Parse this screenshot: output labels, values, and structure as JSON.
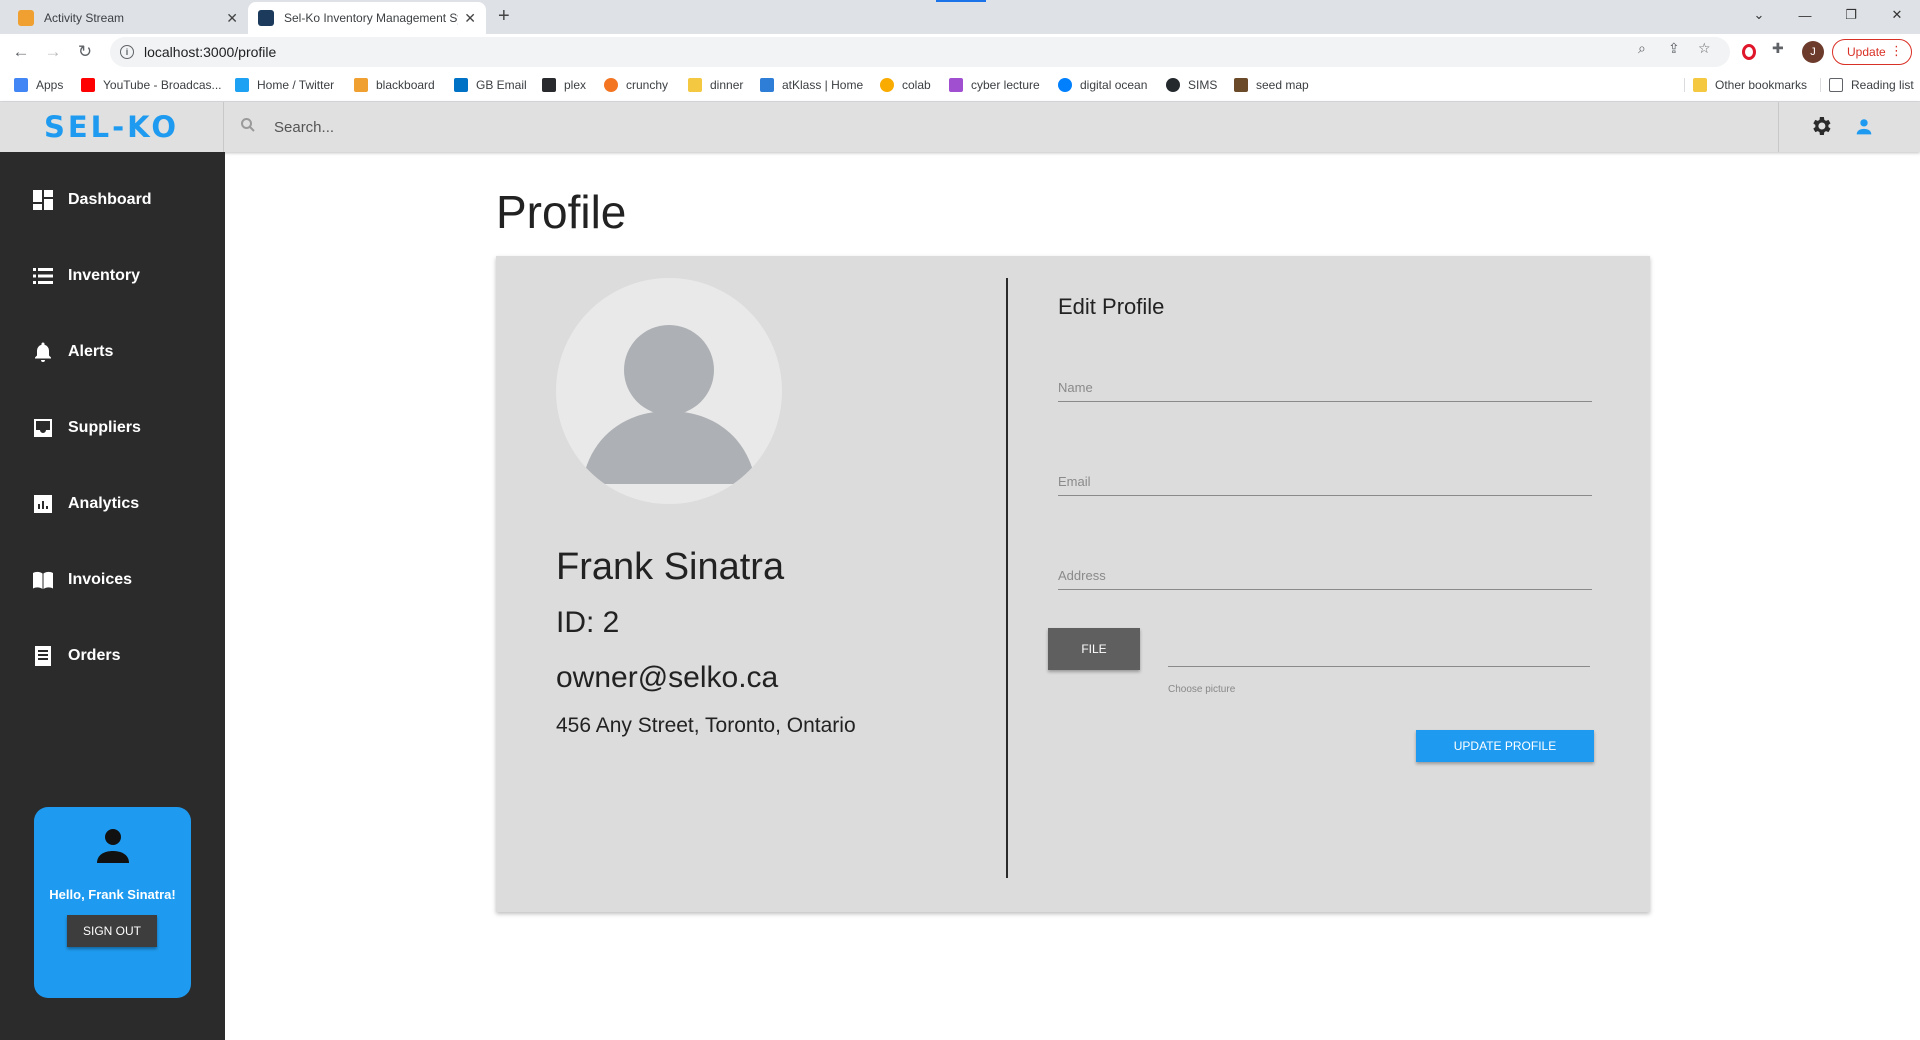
{
  "browser": {
    "tabs": [
      {
        "title": "Activity Stream",
        "fav_color": "#f0a030"
      },
      {
        "title": "Sel-Ko Inventory Management Sy",
        "fav_color": "#1b3a5c"
      }
    ],
    "url": "localhost:3000/profile",
    "update_label": "Update",
    "avatar_letter": "J",
    "bookmarks": [
      {
        "label": "Apps",
        "color": "#4285f4"
      },
      {
        "label": "YouTube - Broadcas...",
        "color": "#ff0000"
      },
      {
        "label": "Home / Twitter",
        "color": "#1da1f2"
      },
      {
        "label": "blackboard",
        "color": "#f0a030"
      },
      {
        "label": "GB Email",
        "color": "#0072c6"
      },
      {
        "label": "plex",
        "color": "#282a2d"
      },
      {
        "label": "crunchy",
        "color": "#f47521"
      },
      {
        "label": "dinner",
        "color": "#f5c842"
      },
      {
        "label": "atKlass | Home",
        "color": "#2e7dd7"
      },
      {
        "label": "colab",
        "color": "#f9ab00"
      },
      {
        "label": "cyber lecture",
        "color": "#a14fd1"
      },
      {
        "label": "digital ocean",
        "color": "#0080ff"
      },
      {
        "label": "SIMS",
        "color": "#24292e"
      },
      {
        "label": "seed map",
        "color": "#6b4a2a"
      }
    ],
    "other_bookmarks": "Other bookmarks",
    "reading_list": "Reading list"
  },
  "app": {
    "logo": "SEL-KO",
    "search_placeholder": "Search...",
    "brand_color": "#1e9bf0",
    "nav": [
      {
        "label": "Dashboard",
        "icon": "dashboard-icon"
      },
      {
        "label": "Inventory",
        "icon": "list-icon"
      },
      {
        "label": "Alerts",
        "icon": "bell-icon"
      },
      {
        "label": "Suppliers",
        "icon": "inbox-icon"
      },
      {
        "label": "Analytics",
        "icon": "analytics-icon"
      },
      {
        "label": "Invoices",
        "icon": "book-icon"
      },
      {
        "label": "Orders",
        "icon": "receipt-icon"
      }
    ],
    "user_card": {
      "greeting": "Hello, Frank Sinatra!",
      "signout_label": "SIGN OUT"
    }
  },
  "main": {
    "title": "Profile",
    "profile": {
      "name": "Frank Sinatra",
      "id": "ID: 2",
      "email": "owner@selko.ca",
      "address": "456 Any Street, Toronto, Ontario"
    },
    "edit": {
      "title": "Edit Profile",
      "name_placeholder": "Name",
      "email_placeholder": "Email",
      "address_placeholder": "Address",
      "file_label": "FILE",
      "file_helper": "Choose picture",
      "submit_label": "UPDATE PROFILE"
    }
  }
}
